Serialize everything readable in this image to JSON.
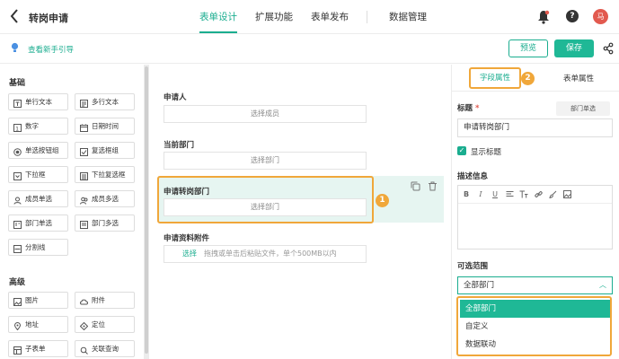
{
  "header": {
    "title": "转岗申请",
    "tabs": [
      {
        "label": "表单设计",
        "active": true
      },
      {
        "label": "扩展功能",
        "active": false
      },
      {
        "label": "表单发布",
        "active": false
      },
      {
        "label": "数据管理",
        "active": false
      }
    ],
    "avatar_text": "马",
    "help_text": "?"
  },
  "toolbar": {
    "guide_link": "查看新手引导",
    "preview_label": "预览",
    "save_label": "保存"
  },
  "palette": {
    "basic_title": "基础",
    "basic_items": [
      "单行文本",
      "多行文本",
      "数字",
      "日期时间",
      "单选按钮组",
      "复选框组",
      "下拉框",
      "下拉复选框",
      "成员单选",
      "成员多选",
      "部门单选",
      "部门多选",
      "分割线"
    ],
    "advanced_title": "高级",
    "advanced_items": [
      "图片",
      "附件",
      "地址",
      "定位",
      "子表单",
      "关联查询"
    ]
  },
  "canvas": {
    "fields": [
      {
        "label": "申请人",
        "placeholder": "选择成员"
      },
      {
        "label": "当前部门",
        "placeholder": "选择部门"
      },
      {
        "label": "申请转岗部门",
        "placeholder": "选择部门"
      }
    ],
    "attachment": {
      "label": "申请资料附件",
      "pick": "选择",
      "hint": "拖拽或单击后粘贴文件，单个500MB以内"
    },
    "badge_1": "1"
  },
  "right_panel": {
    "tab_field": "字段属性",
    "tab_form": "表单属性",
    "badge_2": "2",
    "title_label": "标题",
    "required_mark": "*",
    "type_tag": "部门单选",
    "title_value": "申请转岗部门",
    "show_title_label": "显示标题",
    "desc_label": "描述信息",
    "editor_tools": [
      "B",
      "I",
      "U"
    ],
    "range_label": "可选范围",
    "range_value": "全部部门",
    "range_options": [
      "全部部门",
      "自定义",
      "数据联动"
    ]
  },
  "colors": {
    "accent": "#1aad8f",
    "highlight": "#f0a73a",
    "selected_bg": "#e6f5f1"
  }
}
